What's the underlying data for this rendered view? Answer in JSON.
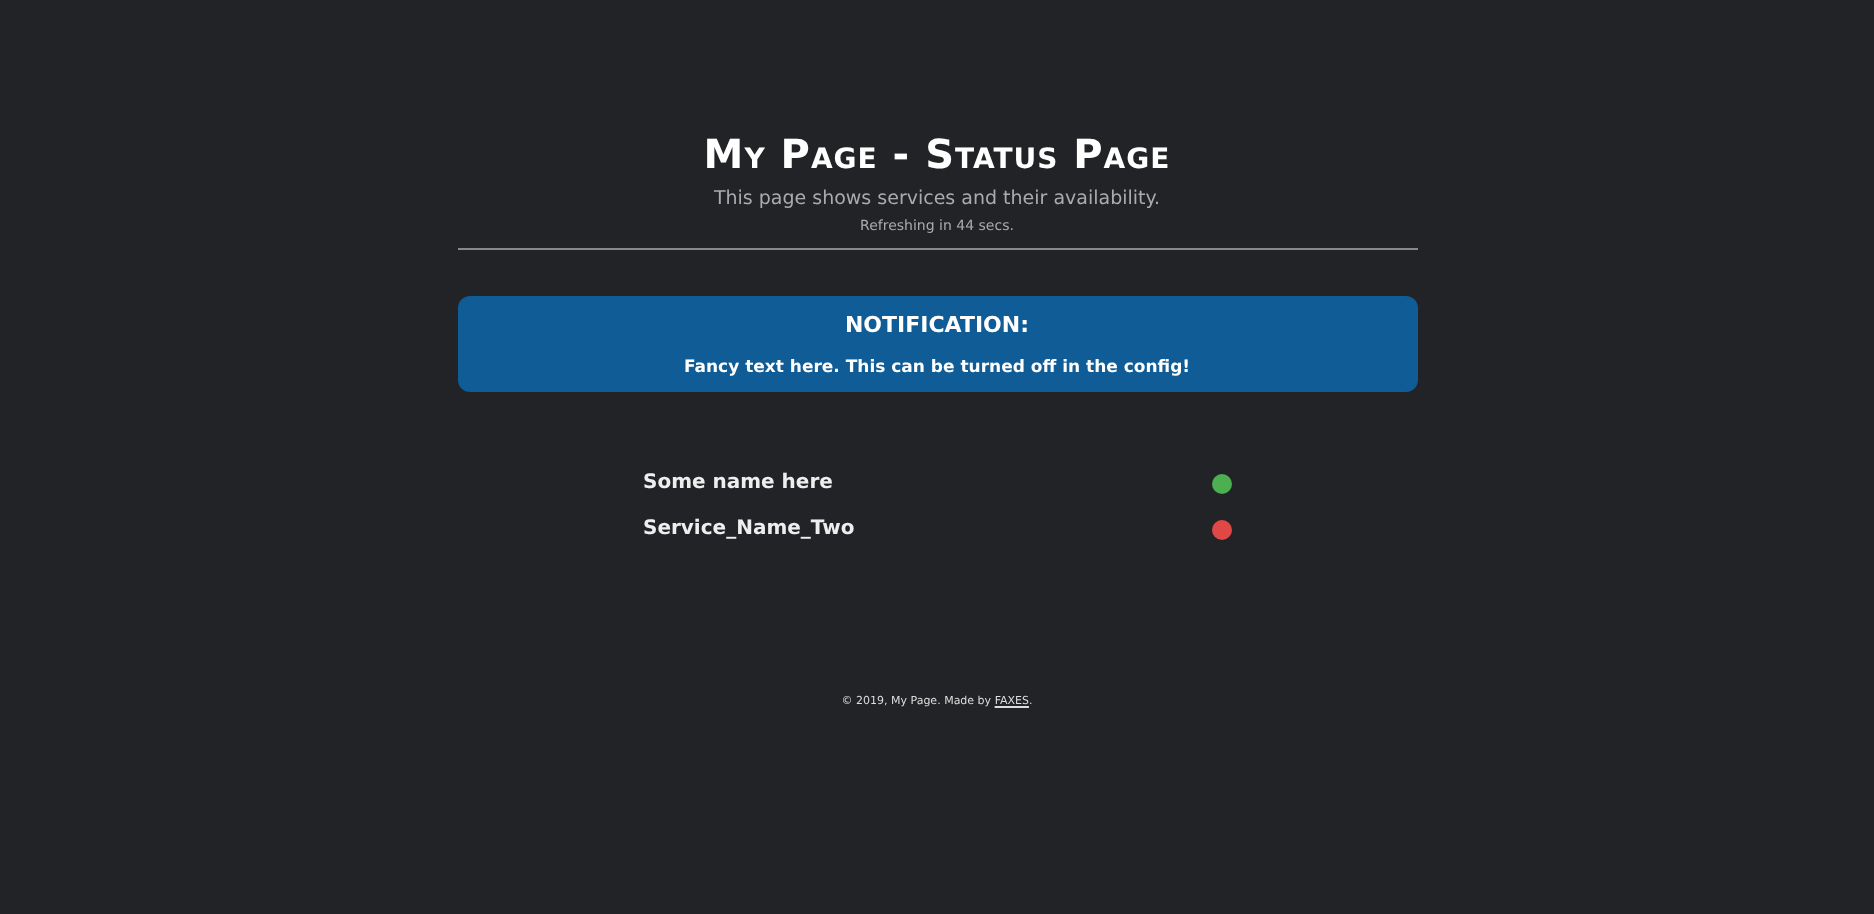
{
  "header": {
    "title": "My Page - Status Page",
    "subtitle": "This page shows services and their availability.",
    "refresh": "Refreshing in 44 secs."
  },
  "notification": {
    "title": "NOTIFICATION:",
    "text": "Fancy text here. This can be turned off in the config!"
  },
  "services": [
    {
      "name": "Some name here",
      "color": "#4caf50"
    },
    {
      "name": "Service_Name_Two",
      "color": "#e04848"
    }
  ],
  "footer": {
    "text": "© 2019, My Page. Made by ",
    "link": "FAXES",
    "end": "."
  }
}
